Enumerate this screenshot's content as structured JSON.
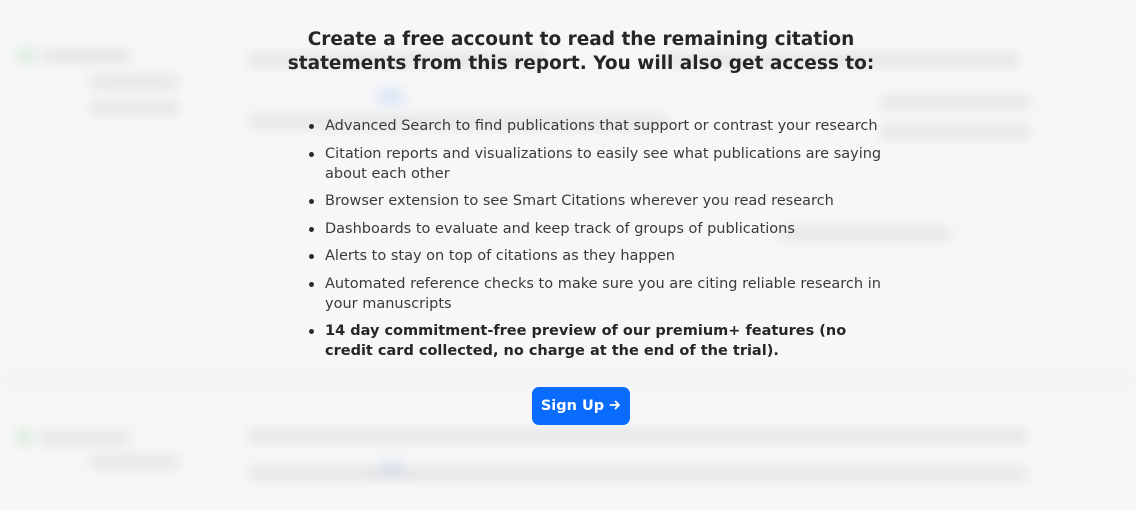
{
  "modal": {
    "headline": "Create a free account to read the remaining citation statements from this report. You will also get access to:",
    "features": [
      "Advanced Search to find publications that support or contrast your research",
      "Citation reports and visualizations to easily see what publications are saying about each other",
      "Browser extension to see Smart Citations wherever you read research",
      "Dashboards to evaluate and keep track of groups of publications",
      "Alerts to stay on top of citations as they happen",
      "Automated reference checks to make sure you are citing reliable research in your manuscripts",
      "14 day commitment-free preview of our premium+ features (no credit card collected, no charge at the end of the trial)."
    ],
    "signup_label": "Sign Up",
    "signup_icon": "arrow-right-icon"
  },
  "colors": {
    "background": "#f7f7f7",
    "button": "#0a6cff",
    "button_text": "#ffffff",
    "text": "#2b2b2b"
  }
}
